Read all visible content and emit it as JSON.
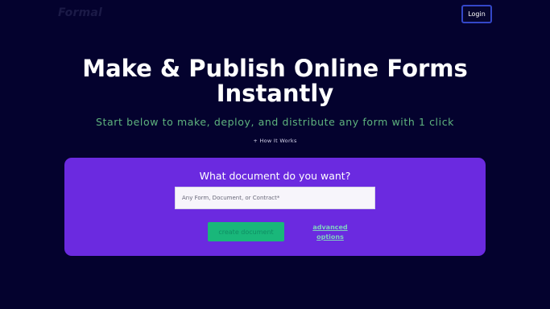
{
  "header": {
    "logo": "Formal",
    "login_label": "Login"
  },
  "hero": {
    "title_line1": "Make & Publish Online Forms",
    "title_line2": "Instantly",
    "subtitle": "Start below to make, deploy, and distribute any form with 1 click",
    "how_it_works": "+ How It Works"
  },
  "panel": {
    "title": "What document do you want?",
    "input_placeholder": "Any Form, Document, or Contract*",
    "input_value": "",
    "create_label": "create document",
    "advanced_label": "advanced options"
  },
  "colors": {
    "background": "#04022e",
    "panel": "#6b2ae0",
    "accent_green": "#19b77a",
    "subtitle_green": "#5fb47e",
    "login_border": "#3447c8"
  }
}
